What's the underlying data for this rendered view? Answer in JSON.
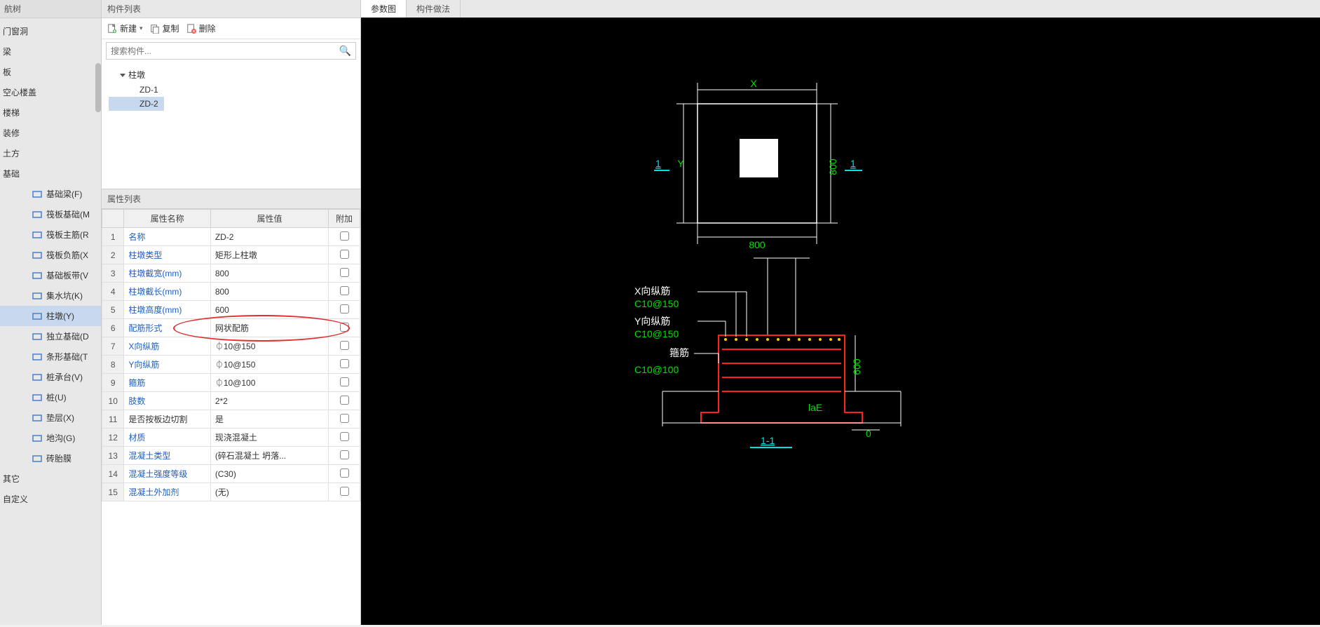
{
  "nav": {
    "header": "航树",
    "items": [
      {
        "label": "门窗洞",
        "indent": false
      },
      {
        "label": "梁",
        "indent": false
      },
      {
        "label": "板",
        "indent": false
      },
      {
        "label": "空心楼盖",
        "indent": false
      },
      {
        "label": "楼梯",
        "indent": false
      },
      {
        "label": "装修",
        "indent": false
      },
      {
        "label": "土方",
        "indent": false
      },
      {
        "label": "基础",
        "indent": false
      },
      {
        "label": "基础梁(F)",
        "indent": true,
        "icon": "pencil"
      },
      {
        "label": "筏板基础(M",
        "indent": true,
        "icon": "slab"
      },
      {
        "label": "筏板主筋(R",
        "indent": true,
        "icon": "grid"
      },
      {
        "label": "筏板负筋(X",
        "indent": true,
        "icon": "grid"
      },
      {
        "label": "基础板带(V",
        "indent": true,
        "icon": "bars"
      },
      {
        "label": "集水坑(K)",
        "indent": true,
        "icon": "pit"
      },
      {
        "label": "柱墩(Y)",
        "indent": true,
        "icon": "pier",
        "selected": true
      },
      {
        "label": "独立基础(D",
        "indent": true,
        "icon": "footing"
      },
      {
        "label": "条形基础(T",
        "indent": true,
        "icon": "strip"
      },
      {
        "label": "桩承台(V)",
        "indent": true,
        "icon": "cap"
      },
      {
        "label": "桩(U)",
        "indent": true,
        "icon": "pile"
      },
      {
        "label": "垫层(X)",
        "indent": true,
        "icon": "bed"
      },
      {
        "label": "地沟(G)",
        "indent": true,
        "icon": "trench"
      },
      {
        "label": "砖胎膜",
        "indent": true,
        "icon": "brick"
      },
      {
        "label": "其它",
        "indent": false
      },
      {
        "label": "自定义",
        "indent": false
      }
    ]
  },
  "compList": {
    "title": "构件列表",
    "toolbar": {
      "new": "新建",
      "copy": "复制",
      "delete": "删除"
    },
    "searchPlaceholder": "搜索构件...",
    "root": "柱墩",
    "items": [
      "ZD-1",
      "ZD-2"
    ],
    "selectedIndex": 1
  },
  "propList": {
    "title": "属性列表",
    "headers": {
      "name": "属性名称",
      "value": "属性值",
      "extra": "附加"
    },
    "rows": [
      {
        "n": "1",
        "name": "名称",
        "val": "ZD-2",
        "blue": true
      },
      {
        "n": "2",
        "name": "柱墩类型",
        "val": "矩形上柱墩",
        "blue": true
      },
      {
        "n": "3",
        "name": "柱墩截宽(mm)",
        "val": "800",
        "blue": true
      },
      {
        "n": "4",
        "name": "柱墩截长(mm)",
        "val": "800",
        "blue": true
      },
      {
        "n": "5",
        "name": "柱墩高度(mm)",
        "val": "600",
        "blue": true
      },
      {
        "n": "6",
        "name": "配筋形式",
        "val": "网状配筋",
        "blue": true,
        "highlight": true
      },
      {
        "n": "7",
        "name": "X向纵筋",
        "val": "⏀10@150",
        "blue": true
      },
      {
        "n": "8",
        "name": "Y向纵筋",
        "val": "⏀10@150",
        "blue": true
      },
      {
        "n": "9",
        "name": "箍筋",
        "val": "⏀10@100",
        "blue": true
      },
      {
        "n": "10",
        "name": "肢数",
        "val": "2*2",
        "blue": true
      },
      {
        "n": "11",
        "name": "是否按板边切割",
        "val": "是",
        "blue": false
      },
      {
        "n": "12",
        "name": "材质",
        "val": "现浇混凝土",
        "blue": true
      },
      {
        "n": "13",
        "name": "混凝土类型",
        "val": "(碎石混凝土 坍落...",
        "blue": true
      },
      {
        "n": "14",
        "name": "混凝土强度等级",
        "val": "(C30)",
        "blue": true
      },
      {
        "n": "15",
        "name": "混凝土外加剂",
        "val": "(无)",
        "blue": true
      }
    ]
  },
  "viewer": {
    "tabs": [
      {
        "label": "参数图",
        "active": true
      },
      {
        "label": "构件做法",
        "active": false
      }
    ],
    "plan": {
      "X": "X",
      "Y": "Y",
      "w": "800",
      "h": "800",
      "sec1": "1",
      "sec1b": "1"
    },
    "section": {
      "xLabel": "X向纵筋",
      "xVal": "C10@150",
      "yLabel": "Y向纵筋",
      "yVal": "C10@150",
      "stirrupLabel": "箍筋",
      "stirrupVal": "C10@100",
      "h": "600",
      "lae": "laE",
      "zero": "0",
      "secTitle": "1-1"
    }
  }
}
